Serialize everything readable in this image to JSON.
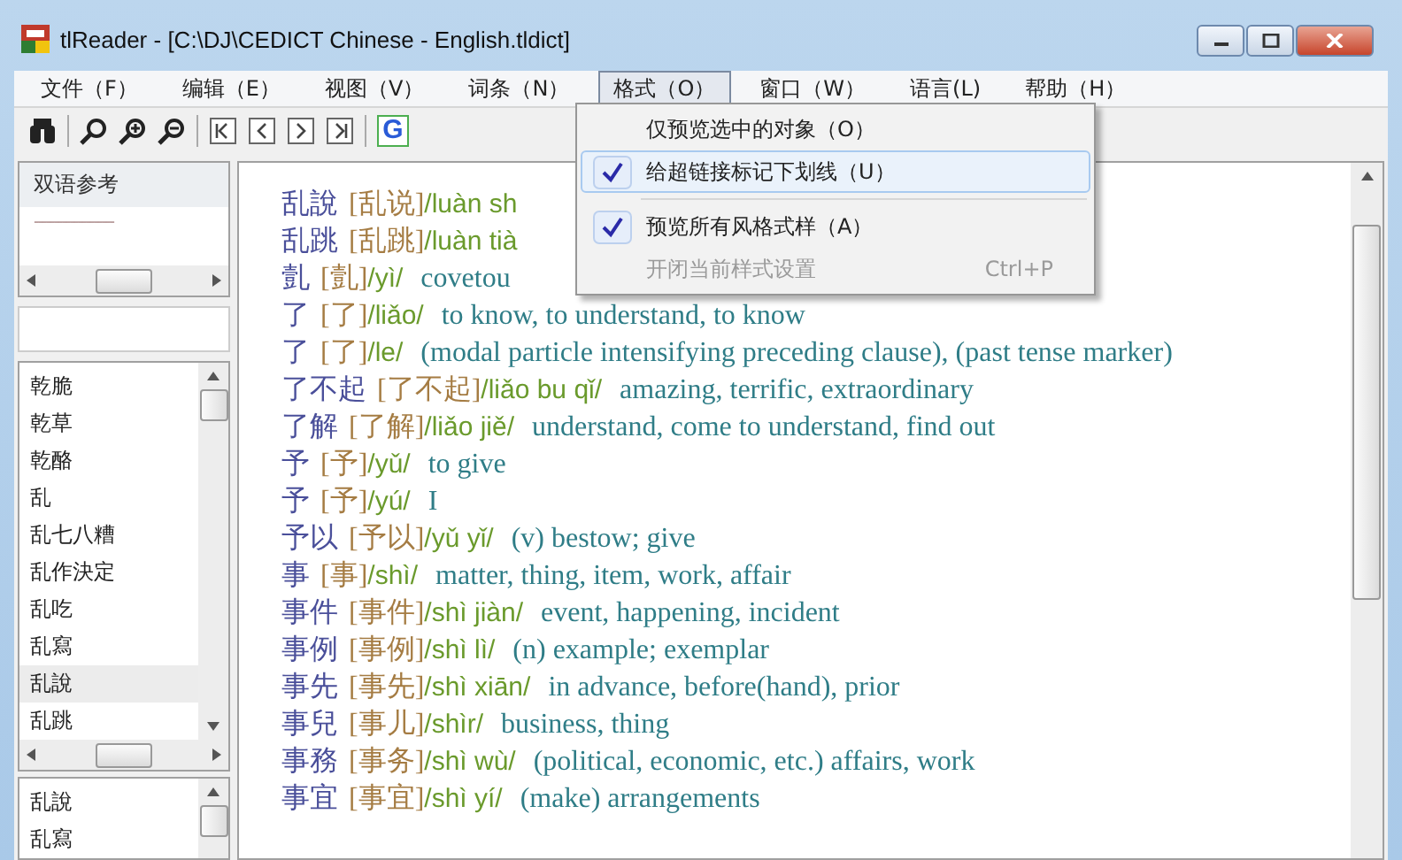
{
  "window": {
    "title": "tlReader - [C:\\DJ\\CEDICT Chinese - English.tldict]"
  },
  "menu_bar": [
    {
      "label": "文件（F）",
      "selected": false
    },
    {
      "label": "编辑（E）",
      "selected": false
    },
    {
      "label": "视图（V）",
      "selected": false
    },
    {
      "label": "词条（N）",
      "selected": false
    },
    {
      "label": "格式（O）",
      "selected": true
    },
    {
      "label": "窗口（W）",
      "selected": false
    },
    {
      "label": "语言(L)",
      "selected": false
    },
    {
      "label": "帮助（H）",
      "selected": false
    }
  ],
  "format_menu": [
    {
      "kind": "item",
      "label": "仅预览选中的对象（O）",
      "checked": false,
      "selected": false,
      "disabled": false
    },
    {
      "kind": "item",
      "label": "给超链接标记下划线（U）",
      "checked": true,
      "selected": true,
      "disabled": false
    },
    {
      "kind": "separator"
    },
    {
      "kind": "item",
      "label": "预览所有风格式样（A）",
      "checked": true,
      "selected": false,
      "disabled": false
    },
    {
      "kind": "item",
      "label": "开闭当前样式设置",
      "checked": false,
      "selected": false,
      "disabled": true,
      "shortcut": "Ctrl+P"
    }
  ],
  "toolbar": {
    "web_search_badge": "G"
  },
  "reference_panel": {
    "title": "双语参考",
    "line": "--------------------"
  },
  "word_list": [
    {
      "label": "乾脆",
      "selected": false
    },
    {
      "label": "乾草",
      "selected": false
    },
    {
      "label": "乾酪",
      "selected": false
    },
    {
      "label": "乱",
      "selected": false
    },
    {
      "label": "乱七八糟",
      "selected": false
    },
    {
      "label": "乱作決定",
      "selected": false
    },
    {
      "label": "乱吃",
      "selected": false
    },
    {
      "label": "乱寫",
      "selected": false
    },
    {
      "label": "乱說",
      "selected": true
    },
    {
      "label": "乱跳",
      "selected": false
    }
  ],
  "history_list": [
    "乱說",
    "乱寫"
  ],
  "entries": [
    {
      "head": "乱說",
      "simp": "[乱说]",
      "pinyin": "/luàn sh"
    },
    {
      "head": "乱跳",
      "simp": "[乱跳]",
      "pinyin": "/luàn tià"
    },
    {
      "head": "亄",
      "simp": "[亄]",
      "pinyin": "/yì/",
      "definition": "covetou"
    },
    {
      "head": "了",
      "simp": "[了]",
      "pinyin": "/liǎo/",
      "definition": "to know, to understand, to know"
    },
    {
      "head": "了",
      "simp": "[了]",
      "pinyin": "/le/",
      "definition": "(modal particle intensifying preceding clause), (past tense marker)"
    },
    {
      "head": "了不起",
      "simp": "[了不起]",
      "pinyin": "/liǎo bu qǐ/",
      "definition": "amazing, terrific, extraordinary"
    },
    {
      "head": "了解",
      "simp": "[了解]",
      "pinyin": "/liǎo jiě/",
      "definition": "understand, come to understand, find out"
    },
    {
      "head": "予",
      "simp": "[予]",
      "pinyin": "/yǔ/",
      "definition": "to give"
    },
    {
      "head": "予",
      "simp": "[予]",
      "pinyin": "/yú/",
      "definition": "I"
    },
    {
      "head": "予以",
      "simp": "[予以]",
      "pinyin": "/yǔ yǐ/",
      "definition": "(v) bestow; give"
    },
    {
      "head": "事",
      "simp": "[事]",
      "pinyin": "/shì/",
      "definition": "matter, thing, item, work, affair"
    },
    {
      "head": "事件",
      "simp": "[事件]",
      "pinyin": "/shì jiàn/",
      "definition": "event, happening, incident"
    },
    {
      "head": "事例",
      "simp": "[事例]",
      "pinyin": "/shì lì/",
      "definition": "(n) example; exemplar"
    },
    {
      "head": "事先",
      "simp": "[事先]",
      "pinyin": "/shì xiān/",
      "definition": "in advance, before(hand), prior"
    },
    {
      "head": "事兒",
      "simp": "[事儿]",
      "pinyin": "/shìr/",
      "definition": "business, thing"
    },
    {
      "head": "事務",
      "simp": "[事务]",
      "pinyin": "/shì wù/",
      "definition": "(political, economic, etc.) affairs, work"
    },
    {
      "head": "事宜",
      "simp": "[事宜]",
      "pinyin": "/shì yí/",
      "definition": "(make) arrangements"
    }
  ]
}
